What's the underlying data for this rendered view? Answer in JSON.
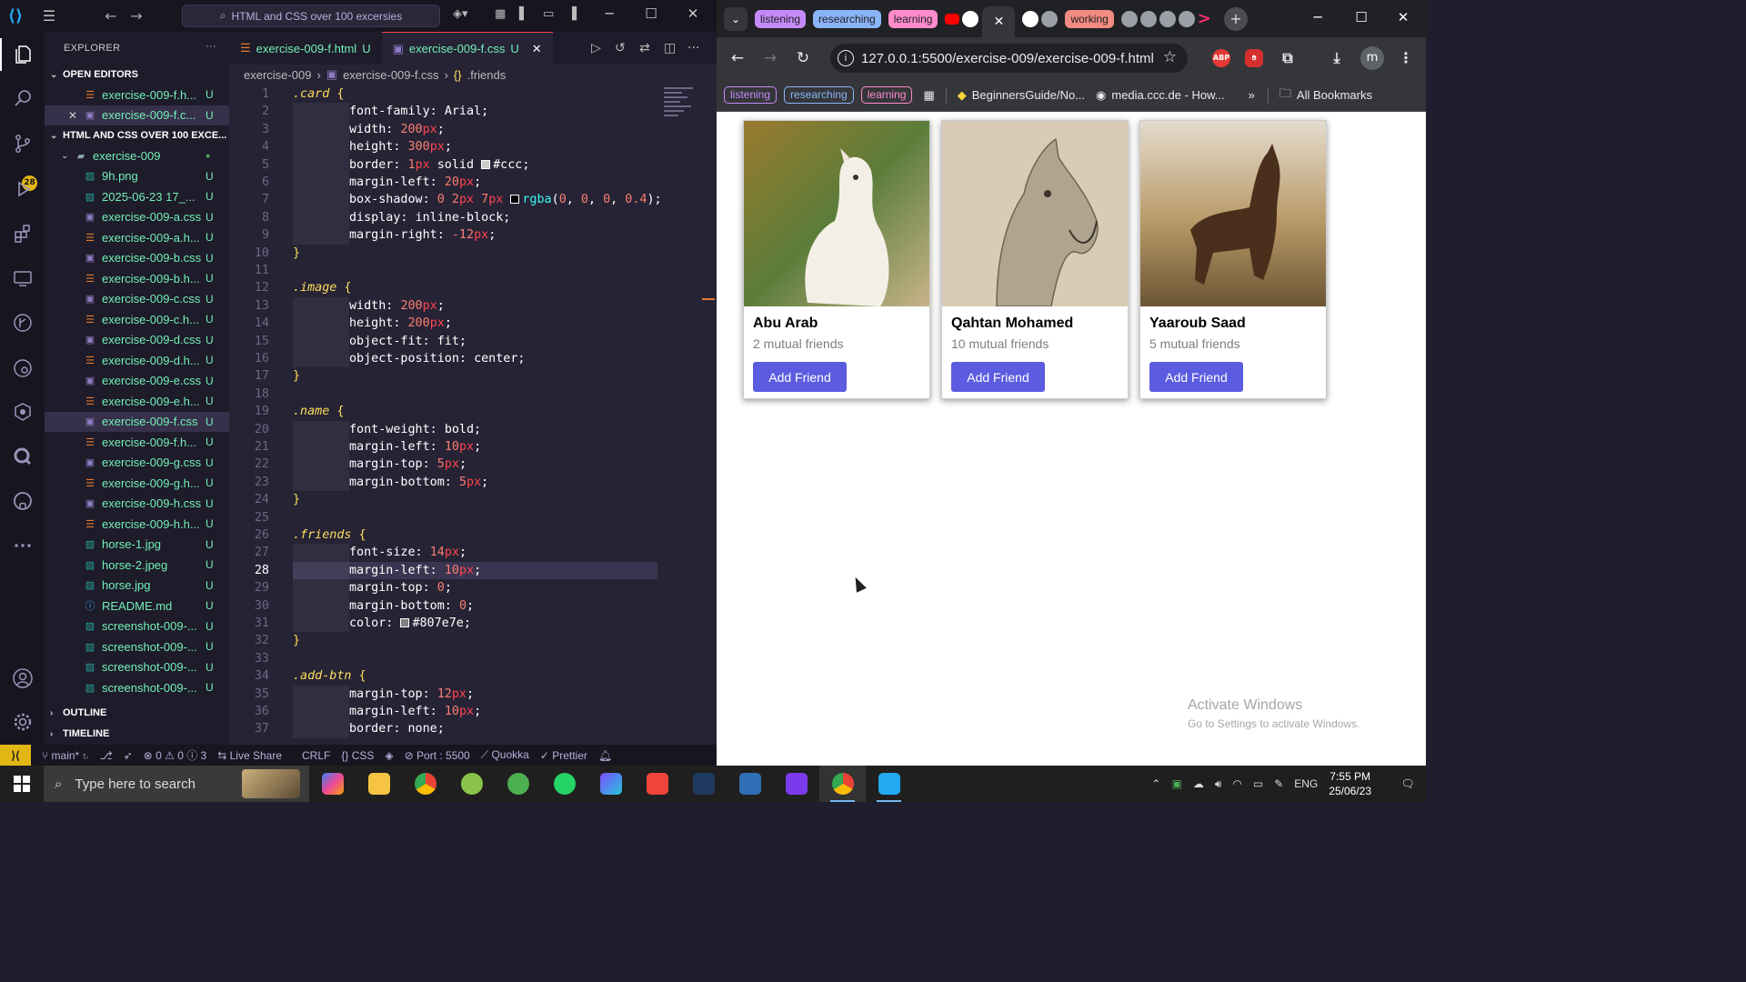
{
  "vscode": {
    "search_text": "HTML and CSS over 100 excersies",
    "explorer_title": "EXPLORER",
    "open_editors_title": "OPEN EDITORS",
    "open_editors": [
      {
        "name": "exercise-009-f.h...",
        "status": "U",
        "type": "html"
      },
      {
        "name": "exercise-009-f.c...",
        "status": "U",
        "type": "css"
      }
    ],
    "workspace_title": "HTML AND CSS OVER 100 EXCE...",
    "folder": "exercise-009",
    "files": [
      {
        "name": "9h.png",
        "status": "U",
        "type": "img"
      },
      {
        "name": "2025-06-23 17_...",
        "status": "U",
        "type": "img"
      },
      {
        "name": "exercise-009-a.css",
        "status": "U",
        "type": "css"
      },
      {
        "name": "exercise-009-a.h...",
        "status": "U",
        "type": "html"
      },
      {
        "name": "exercise-009-b.css",
        "status": "U",
        "type": "css"
      },
      {
        "name": "exercise-009-b.h...",
        "status": "U",
        "type": "html"
      },
      {
        "name": "exercise-009-c.css",
        "status": "U",
        "type": "css"
      },
      {
        "name": "exercise-009-c.h...",
        "status": "U",
        "type": "html"
      },
      {
        "name": "exercise-009-d.css",
        "status": "U",
        "type": "css"
      },
      {
        "name": "exercise-009-d.h...",
        "status": "U",
        "type": "html"
      },
      {
        "name": "exercise-009-e.css",
        "status": "U",
        "type": "css"
      },
      {
        "name": "exercise-009-e.h...",
        "status": "U",
        "type": "html"
      },
      {
        "name": "exercise-009-f.css",
        "status": "U",
        "type": "css"
      },
      {
        "name": "exercise-009-f.h...",
        "status": "U",
        "type": "html"
      },
      {
        "name": "exercise-009-g.css",
        "status": "U",
        "type": "css"
      },
      {
        "name": "exercise-009-g.h...",
        "status": "U",
        "type": "html"
      },
      {
        "name": "exercise-009-h.css",
        "status": "U",
        "type": "css"
      },
      {
        "name": "exercise-009-h.h...",
        "status": "U",
        "type": "html"
      },
      {
        "name": "horse-1.jpg",
        "status": "U",
        "type": "img"
      },
      {
        "name": "horse-2.jpeg",
        "status": "U",
        "type": "img"
      },
      {
        "name": "horse.jpg",
        "status": "U",
        "type": "img"
      },
      {
        "name": "README.md",
        "status": "U",
        "type": "info"
      },
      {
        "name": "screenshot-009-...",
        "status": "U",
        "type": "img"
      },
      {
        "name": "screenshot-009-...",
        "status": "U",
        "type": "img"
      },
      {
        "name": "screenshot-009-...",
        "status": "U",
        "type": "img"
      },
      {
        "name": "screenshot-009-...",
        "status": "U",
        "type": "img"
      }
    ],
    "outline_title": "OUTLINE",
    "timeline_title": "TIMELINE",
    "source_control_badge": "28",
    "tabs": [
      {
        "label": "exercise-009-f.html",
        "status": "U"
      },
      {
        "label": "exercise-009-f.css",
        "status": "U"
      }
    ],
    "breadcrumb": [
      "exercise-009",
      "exercise-009-f.css",
      ".friends"
    ],
    "code_lines": [
      [
        {
          "t": ".card",
          "c": "sel-c"
        },
        {
          "t": " {",
          "c": "br"
        }
      ],
      [
        {
          "i": 1
        },
        {
          "t": "font-family: ",
          "c": "prop"
        },
        {
          "t": "Arial;",
          "c": "val"
        }
      ],
      [
        {
          "i": 1
        },
        {
          "t": "width: ",
          "c": "prop"
        },
        {
          "t": "200",
          "c": "num"
        },
        {
          "t": "px",
          "c": "unit"
        },
        {
          "t": ";",
          "c": "val"
        }
      ],
      [
        {
          "i": 1
        },
        {
          "t": "height: ",
          "c": "prop"
        },
        {
          "t": "300",
          "c": "num"
        },
        {
          "t": "px",
          "c": "unit"
        },
        {
          "t": ";",
          "c": "val"
        }
      ],
      [
        {
          "i": 1
        },
        {
          "t": "border: ",
          "c": "prop"
        },
        {
          "t": "1",
          "c": "num"
        },
        {
          "t": "px",
          "c": "unit"
        },
        {
          "t": " solid ",
          "c": "val"
        },
        {
          "sw": "#cccccc"
        },
        {
          "t": "#ccc;",
          "c": "hex"
        }
      ],
      [
        {
          "i": 1
        },
        {
          "t": "margin-left: ",
          "c": "prop"
        },
        {
          "t": "20",
          "c": "num"
        },
        {
          "t": "px",
          "c": "unit"
        },
        {
          "t": ";",
          "c": "val"
        }
      ],
      [
        {
          "i": 1
        },
        {
          "t": "box-shadow: ",
          "c": "prop"
        },
        {
          "t": "0 ",
          "c": "num"
        },
        {
          "t": "2",
          "c": "num"
        },
        {
          "t": "px ",
          "c": "unit"
        },
        {
          "t": "7",
          "c": "num"
        },
        {
          "t": "px ",
          "c": "unit"
        },
        {
          "sw": "#000000"
        },
        {
          "t": "rgba",
          "c": "fn"
        },
        {
          "t": "(",
          "c": "val"
        },
        {
          "t": "0",
          "c": "num"
        },
        {
          "t": ", ",
          "c": "val"
        },
        {
          "t": "0",
          "c": "num"
        },
        {
          "t": ", ",
          "c": "val"
        },
        {
          "t": "0",
          "c": "num"
        },
        {
          "t": ", ",
          "c": "val"
        },
        {
          "t": "0.4",
          "c": "num"
        },
        {
          "t": ");",
          "c": "val"
        }
      ],
      [
        {
          "i": 1
        },
        {
          "t": "display: ",
          "c": "prop"
        },
        {
          "t": "inline-block;",
          "c": "val"
        }
      ],
      [
        {
          "i": 1
        },
        {
          "t": "margin-right: ",
          "c": "prop"
        },
        {
          "t": "-12",
          "c": "num"
        },
        {
          "t": "px",
          "c": "unit"
        },
        {
          "t": ";",
          "c": "val"
        }
      ],
      [
        {
          "t": "}",
          "c": "br"
        }
      ],
      [],
      [
        {
          "t": ".image",
          "c": "sel-c"
        },
        {
          "t": " {",
          "c": "br"
        }
      ],
      [
        {
          "i": 1
        },
        {
          "t": "width: ",
          "c": "prop"
        },
        {
          "t": "200",
          "c": "num"
        },
        {
          "t": "px",
          "c": "unit"
        },
        {
          "t": ";",
          "c": "val"
        }
      ],
      [
        {
          "i": 1
        },
        {
          "t": "height: ",
          "c": "prop"
        },
        {
          "t": "200",
          "c": "num"
        },
        {
          "t": "px",
          "c": "unit"
        },
        {
          "t": ";",
          "c": "val"
        }
      ],
      [
        {
          "i": 1
        },
        {
          "t": "object-fit: ",
          "c": "prop"
        },
        {
          "t": "fit;",
          "c": "val"
        }
      ],
      [
        {
          "i": 1
        },
        {
          "t": "object-position: ",
          "c": "prop"
        },
        {
          "t": "center;",
          "c": "val"
        }
      ],
      [
        {
          "t": "}",
          "c": "br"
        }
      ],
      [],
      [
        {
          "t": ".name",
          "c": "sel-c"
        },
        {
          "t": " {",
          "c": "br"
        }
      ],
      [
        {
          "i": 1
        },
        {
          "t": "font-weight: ",
          "c": "prop"
        },
        {
          "t": "bold;",
          "c": "val"
        }
      ],
      [
        {
          "i": 1
        },
        {
          "t": "margin-left: ",
          "c": "prop"
        },
        {
          "t": "10",
          "c": "num"
        },
        {
          "t": "px",
          "c": "unit"
        },
        {
          "t": ";",
          "c": "val"
        }
      ],
      [
        {
          "i": 1
        },
        {
          "t": "margin-top: ",
          "c": "prop"
        },
        {
          "t": "5",
          "c": "num"
        },
        {
          "t": "px",
          "c": "unit"
        },
        {
          "t": ";",
          "c": "val"
        }
      ],
      [
        {
          "i": 1
        },
        {
          "t": "margin-bottom: ",
          "c": "prop"
        },
        {
          "t": "5",
          "c": "num"
        },
        {
          "t": "px",
          "c": "unit"
        },
        {
          "t": ";",
          "c": "val"
        }
      ],
      [
        {
          "t": "}",
          "c": "br"
        }
      ],
      [],
      [
        {
          "t": ".friends",
          "c": "sel-c"
        },
        {
          "t": " {",
          "c": "br"
        }
      ],
      [
        {
          "i": 1
        },
        {
          "t": "font-size: ",
          "c": "prop"
        },
        {
          "t": "14",
          "c": "num"
        },
        {
          "t": "px",
          "c": "unit"
        },
        {
          "t": ";",
          "c": "val"
        }
      ],
      [
        {
          "i": 1
        },
        {
          "t": "margin-left: ",
          "c": "prop"
        },
        {
          "t": "10",
          "c": "num"
        },
        {
          "t": "px",
          "c": "unit"
        },
        {
          "t": ";",
          "c": "val"
        }
      ],
      [
        {
          "i": 1
        },
        {
          "t": "margin-top: ",
          "c": "prop"
        },
        {
          "t": "0",
          "c": "num"
        },
        {
          "t": ";",
          "c": "val"
        }
      ],
      [
        {
          "i": 1
        },
        {
          "t": "margin-bottom: ",
          "c": "prop"
        },
        {
          "t": "0",
          "c": "num"
        },
        {
          "t": ";",
          "c": "val"
        }
      ],
      [
        {
          "i": 1
        },
        {
          "t": "color: ",
          "c": "prop"
        },
        {
          "sw": "#807e7e"
        },
        {
          "t": "#807e7e;",
          "c": "hex"
        }
      ],
      [
        {
          "t": "}",
          "c": "br"
        }
      ],
      [],
      [
        {
          "t": ".add-btn",
          "c": "sel-c"
        },
        {
          "t": " {",
          "c": "br"
        }
      ],
      [
        {
          "i": 1
        },
        {
          "t": "margin-top: ",
          "c": "prop"
        },
        {
          "t": "12",
          "c": "num"
        },
        {
          "t": "px",
          "c": "unit"
        },
        {
          "t": ";",
          "c": "val"
        }
      ],
      [
        {
          "i": 1
        },
        {
          "t": "margin-left: ",
          "c": "prop"
        },
        {
          "t": "10",
          "c": "num"
        },
        {
          "t": "px",
          "c": "unit"
        },
        {
          "t": ";",
          "c": "val"
        }
      ],
      [
        {
          "i": 1
        },
        {
          "t": "border: ",
          "c": "prop"
        },
        {
          "t": "none;",
          "c": "val"
        }
      ]
    ],
    "current_line": 28,
    "status": {
      "branch": "main*",
      "problems": "0",
      "warnings": "0",
      "info": "3",
      "live_share": "Live Share",
      "eol": "CRLF",
      "language": "CSS",
      "port": "Port : 5500",
      "quokka": "Quokka",
      "prettier": "Prettier"
    }
  },
  "chrome": {
    "tab_groups": [
      {
        "label": "listening",
        "color": "#c58af9"
      },
      {
        "label": "researching",
        "color": "#8ab4f8"
      },
      {
        "label": "learning",
        "color": "#ff8bcb"
      },
      {
        "label": "working",
        "color": "#f28b82"
      }
    ],
    "url": "127.0.0.1:5500/exercise-009/exercise-009-f.html",
    "ext_abp": "ABP",
    "profile_initial": "m",
    "bookmark_groups": [
      {
        "label": "listening",
        "color": "#c58af9"
      },
      {
        "label": "researching",
        "color": "#8ab4f8"
      },
      {
        "label": "learning",
        "color": "#ff8bcb"
      }
    ],
    "bookmarks": [
      "BeginnersGuide/No...",
      "media.ccc.de - How..."
    ],
    "all_bookmarks": "All Bookmarks",
    "cards": [
      {
        "name": "Abu Arab",
        "friends": "2 mutual friends",
        "button": "Add Friend"
      },
      {
        "name": "Qahtan Mohamed",
        "friends": "10 mutual friends",
        "button": "Add Friend"
      },
      {
        "name": "Yaaroub Saad",
        "friends": "5 mutual friends",
        "button": "Add Friend"
      }
    ],
    "watermark_title": "Activate Windows",
    "watermark_sub": "Go to Settings to activate Windows."
  },
  "taskbar": {
    "search_placeholder": "Type here to search",
    "lang": "ENG",
    "time": "7:55 PM",
    "date": "25/06/23"
  }
}
